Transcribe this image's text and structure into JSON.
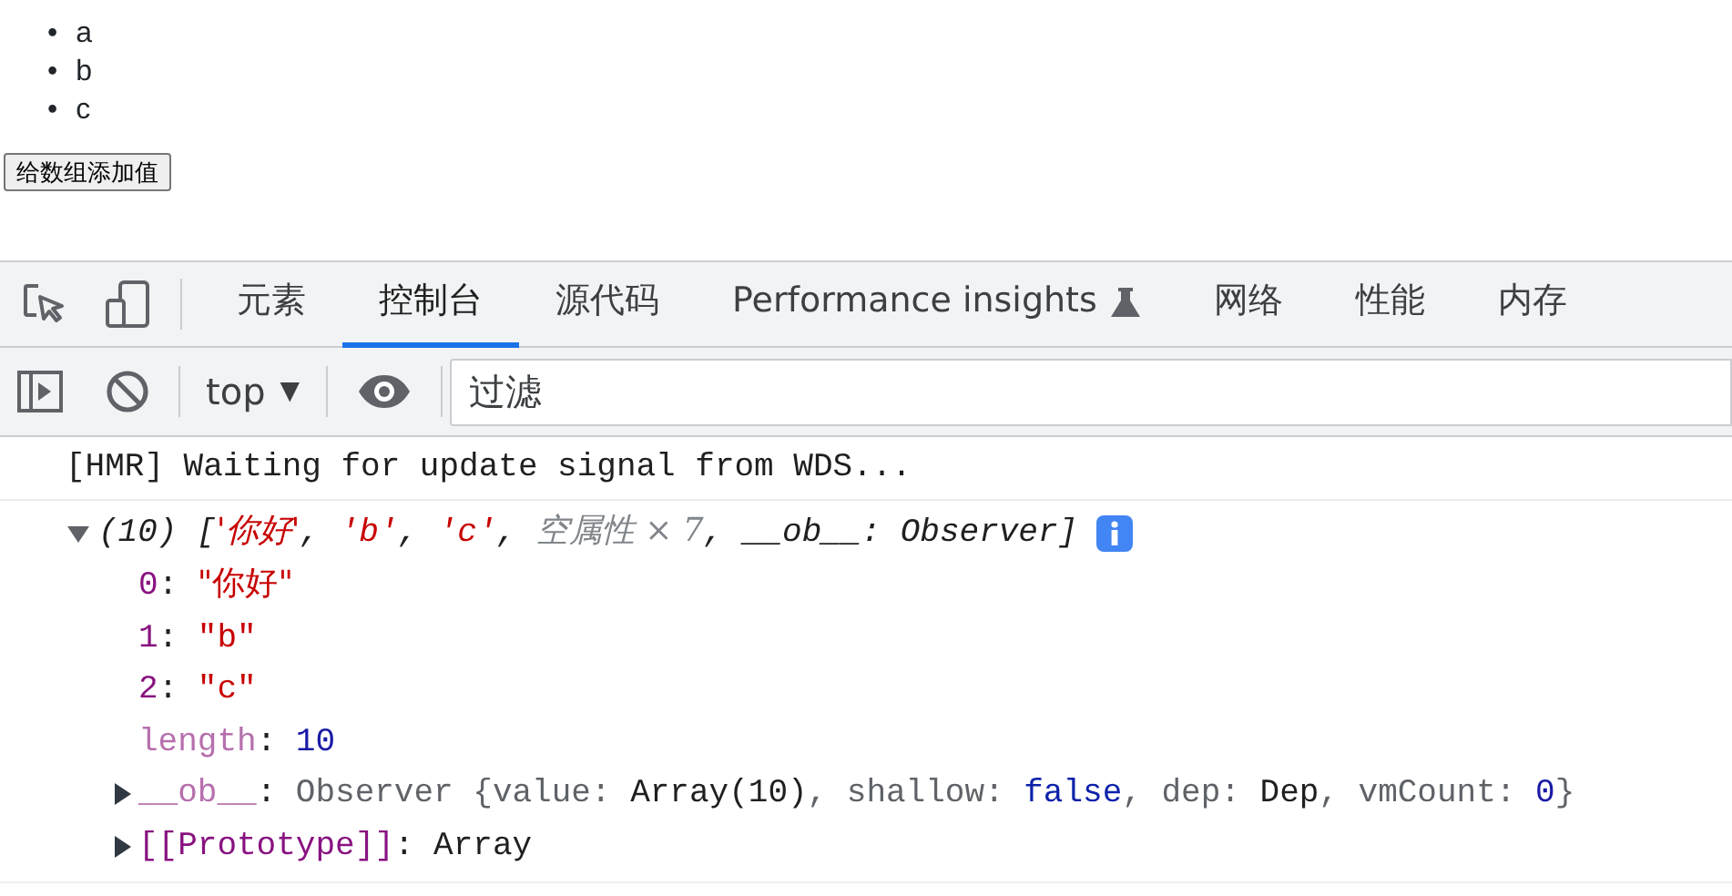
{
  "page": {
    "list": [
      {
        "marker": "•",
        "text": "a"
      },
      {
        "marker": "•",
        "text": "b"
      },
      {
        "marker": "•",
        "text": "c"
      }
    ],
    "button": "给数组添加值"
  },
  "devtools": {
    "tabs": [
      {
        "label": "元素",
        "selected": false
      },
      {
        "label": "控制台",
        "selected": true
      },
      {
        "label": "源代码",
        "selected": false
      },
      {
        "label": "Performance insights",
        "selected": false,
        "experimental": true
      },
      {
        "label": "网络",
        "selected": false
      },
      {
        "label": "性能",
        "selected": false
      },
      {
        "label": "内存",
        "selected": false
      }
    ],
    "toolbar": {
      "context": "top",
      "context_caret": "▼",
      "filter_placeholder": "过滤"
    },
    "console": [
      {
        "kind": "log",
        "text": "[HMR] Waiting for update signal from WDS..."
      },
      {
        "kind": "object",
        "expanded": true,
        "info": true,
        "summary": [
          {
            "t": "(10) [",
            "kind": "plain"
          },
          {
            "t": "'你好'",
            "kind": "string"
          },
          {
            "t": ", ",
            "kind": "plain"
          },
          {
            "t": "'b'",
            "kind": "string"
          },
          {
            "t": ", ",
            "kind": "plain"
          },
          {
            "t": "'c'",
            "kind": "string"
          },
          {
            "t": ", ",
            "kind": "plain"
          },
          {
            "t": "空属性 × 7",
            "kind": "empty"
          },
          {
            "t": ", __ob__: Observer]",
            "kind": "plain"
          }
        ],
        "properties": [
          {
            "key": "0",
            "sep": ":",
            "faded": false,
            "value": [
              {
                "t": "\"你好\"",
                "kind": "string"
              }
            ]
          },
          {
            "key": "1",
            "sep": ":",
            "faded": false,
            "value": [
              {
                "t": "\"b\"",
                "kind": "string"
              }
            ]
          },
          {
            "key": "2",
            "sep": ":",
            "faded": false,
            "value": [
              {
                "t": "\"c\"",
                "kind": "string"
              }
            ]
          },
          {
            "key": "length",
            "sep": ":",
            "faded": true,
            "value": [
              {
                "t": "10",
                "kind": "number"
              }
            ]
          },
          {
            "key": "__ob__",
            "sep": ":",
            "faded": true,
            "expanded": false,
            "value": [
              {
                "t": "Observer {",
                "kind": "dim"
              },
              {
                "t": "value: ",
                "kind": "dim"
              },
              {
                "t": "Array(10)",
                "kind": "plain"
              },
              {
                "t": ", shallow: ",
                "kind": "dim"
              },
              {
                "t": "false",
                "kind": "keyword"
              },
              {
                "t": ", dep: ",
                "kind": "dim"
              },
              {
                "t": "Dep",
                "kind": "plain"
              },
              {
                "t": ", vmCount: ",
                "kind": "dim"
              },
              {
                "t": "0",
                "kind": "number"
              },
              {
                "t": "}",
                "kind": "dim"
              }
            ]
          },
          {
            "key": "[[Prototype]]",
            "sep": ":",
            "faded": false,
            "expanded": false,
            "value": [
              {
                "t": "Array",
                "kind": "plain"
              }
            ]
          }
        ]
      }
    ]
  }
}
